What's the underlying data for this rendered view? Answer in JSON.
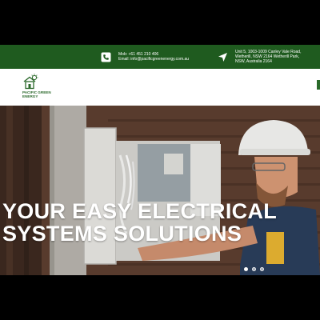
{
  "contact": {
    "phone_line": "Mob: +61 451 210 406",
    "email_line": "Email: info@pacificgreenenergy.com.au",
    "address_line1": "Unit 5, 1003-1009 Canley Vale Road,",
    "address_line2": "Wetherill, NSW 2164 Wetherill Park,",
    "address_line3": "NSW, Australia 2164",
    "phone_icon": "phone-icon",
    "location_icon": "location-arrow-icon"
  },
  "brand": {
    "line1": "PACIFIC GREEN",
    "line2": "ENERGY",
    "logo_icon": "house-sun-logo-icon"
  },
  "hero": {
    "headline_line1": "YOUR EASY ELECTRICAL",
    "headline_line2": "SYSTEMS SOLUTIONS",
    "slides": 3,
    "active_slide": 1
  },
  "colors": {
    "brand_green": "#1f5b1f",
    "logo_green": "#2d6a2d",
    "headline_white": "#ffffff"
  }
}
